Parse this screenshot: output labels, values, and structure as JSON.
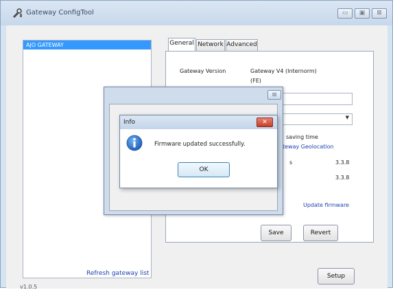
{
  "window": {
    "title": "Gateway ConfigTool",
    "icon": "wrench-plug-icon",
    "minimize_glyph": "▭",
    "maximize_glyph": "▣",
    "close_glyph": "⊠"
  },
  "left_panel": {
    "gateways": [
      "AJO GATEWAY"
    ],
    "refresh_link": "Refresh gateway list",
    "version": "v1.0.5"
  },
  "tabs": [
    {
      "label": "General",
      "active": true
    },
    {
      "label": "Network",
      "active": false
    },
    {
      "label": "Advanced",
      "active": false
    }
  ],
  "general": {
    "gateway_version_label": "Gateway Version",
    "gateway_version_value_line1": "Gateway V4 (Internorm)",
    "gateway_version_value_line2": "(FE)",
    "dst_text": "saving time",
    "geolocation_link": "teway Geolocation",
    "row1_label": "s",
    "row1_value": "3.3.8",
    "row2_value": "3.3.8",
    "update_firmware_link": "Update firmware",
    "save_button": "Save",
    "revert_button": "Revert"
  },
  "setup_button": "Setup",
  "background_dialog": {
    "close_glyph": "⊠"
  },
  "info_dialog": {
    "title": "Info",
    "close_glyph": "✕",
    "icon": "info-icon",
    "message": "Firmware updated successfully.",
    "ok_button": "OK"
  },
  "colors": {
    "selection": "#3399ff",
    "link": "#1b3fae",
    "info_icon": "#1f6fcf",
    "close_red": "#c3402b"
  }
}
